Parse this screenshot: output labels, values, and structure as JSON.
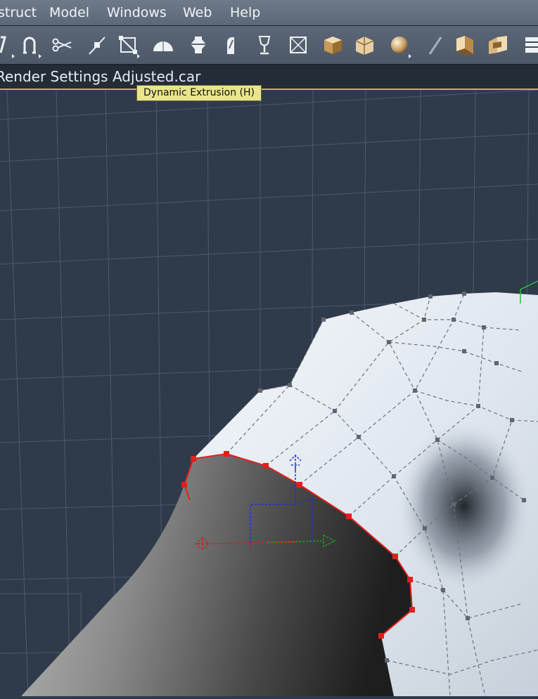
{
  "menu": {
    "items": [
      "struct",
      "Model",
      "Windows",
      "Web",
      "Help"
    ]
  },
  "toolbar": {
    "tools": [
      "hook-tool-icon",
      "magnet-tool-icon",
      "scissors-tool-icon",
      "point-tool-icon",
      "box-select-tool-icon",
      "dome-tool-icon",
      "lathe-tool-icon",
      "bend-tool-icon",
      "goblet-tool-icon",
      "boxed-x-tool-icon",
      "cube-primitive-icon",
      "cube-shade-icon",
      "sphere-primitive-icon",
      "pen-tool-icon",
      "extrude-gold-icon",
      "fold-gold-icon",
      "list-tool-icon"
    ]
  },
  "document": {
    "title": "Render Settings Adjusted.car"
  },
  "tooltip": {
    "text": "Dynamic Extrusion (H)"
  },
  "colors": {
    "viewport_bg": "#2f3a4a",
    "selection": "#e0201c",
    "axis_x": "#d02020",
    "axis_y": "#20a020",
    "axis_z": "#2030d0"
  }
}
